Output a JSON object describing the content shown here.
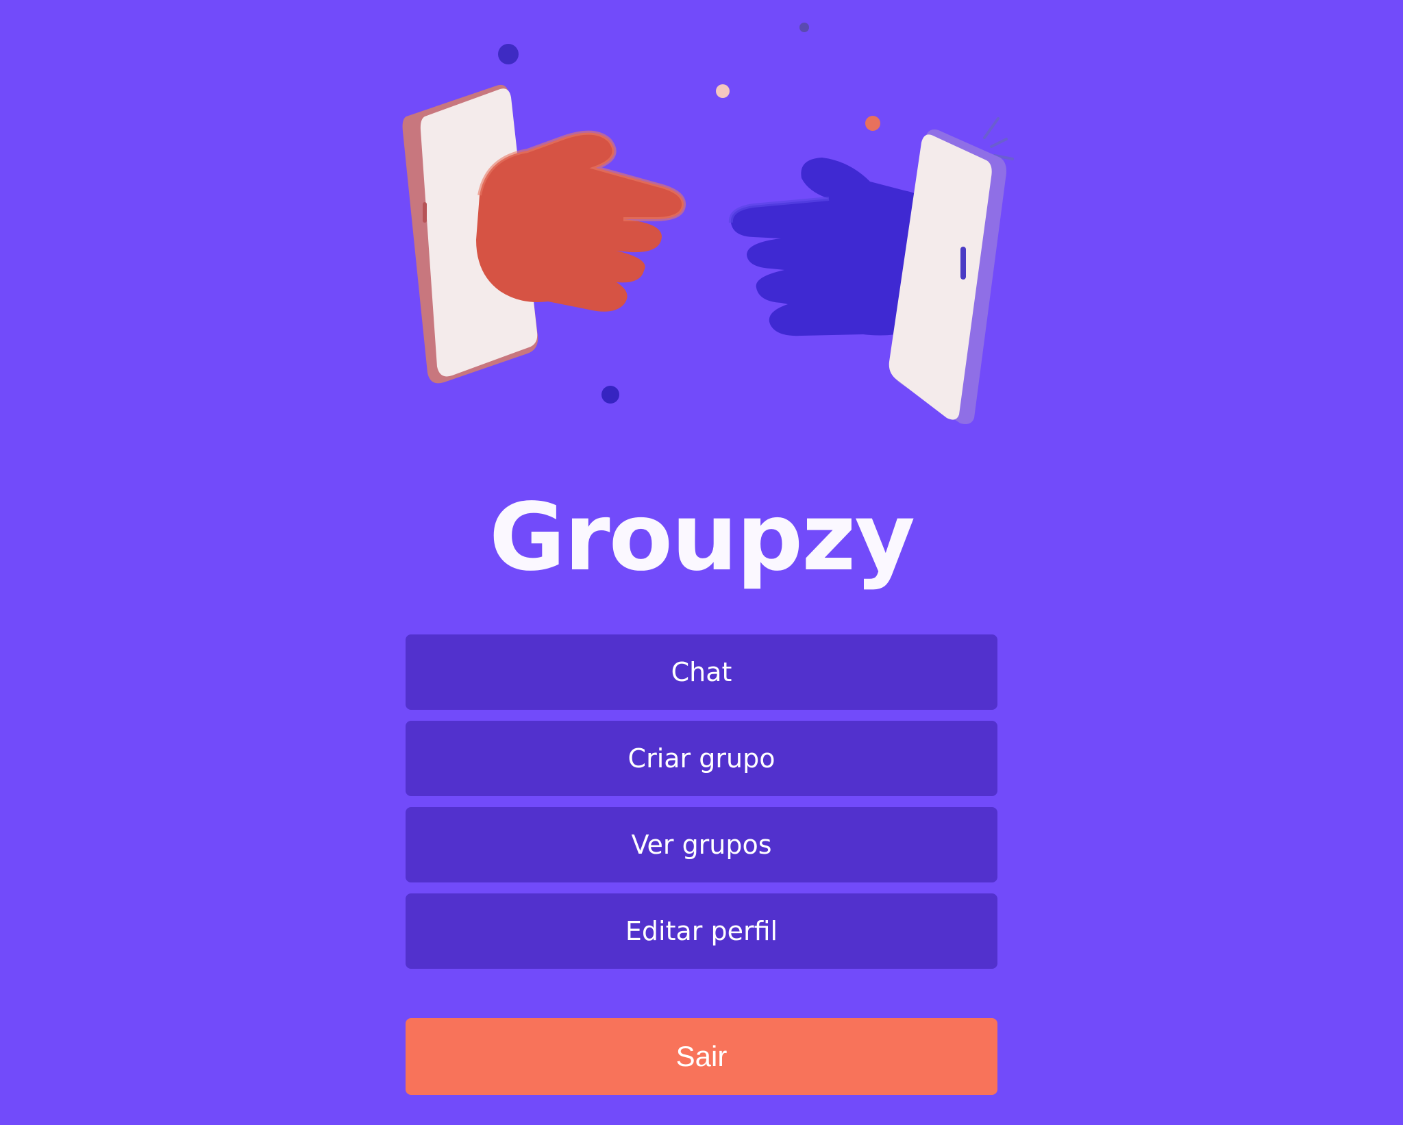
{
  "app": {
    "title": "Groupzy"
  },
  "hero": {
    "illustration": "two-hands-reaching-from-phones"
  },
  "menu": {
    "items": [
      {
        "label": "Chat"
      },
      {
        "label": "Criar grupo"
      },
      {
        "label": "Ver grupos"
      },
      {
        "label": "Editar perfil"
      }
    ]
  },
  "logout": {
    "label": "Sair"
  },
  "colors": {
    "background": "#724bfa",
    "menu_button": "#5231cd",
    "logout_button": "#f8735a",
    "text": "#ffffff"
  }
}
